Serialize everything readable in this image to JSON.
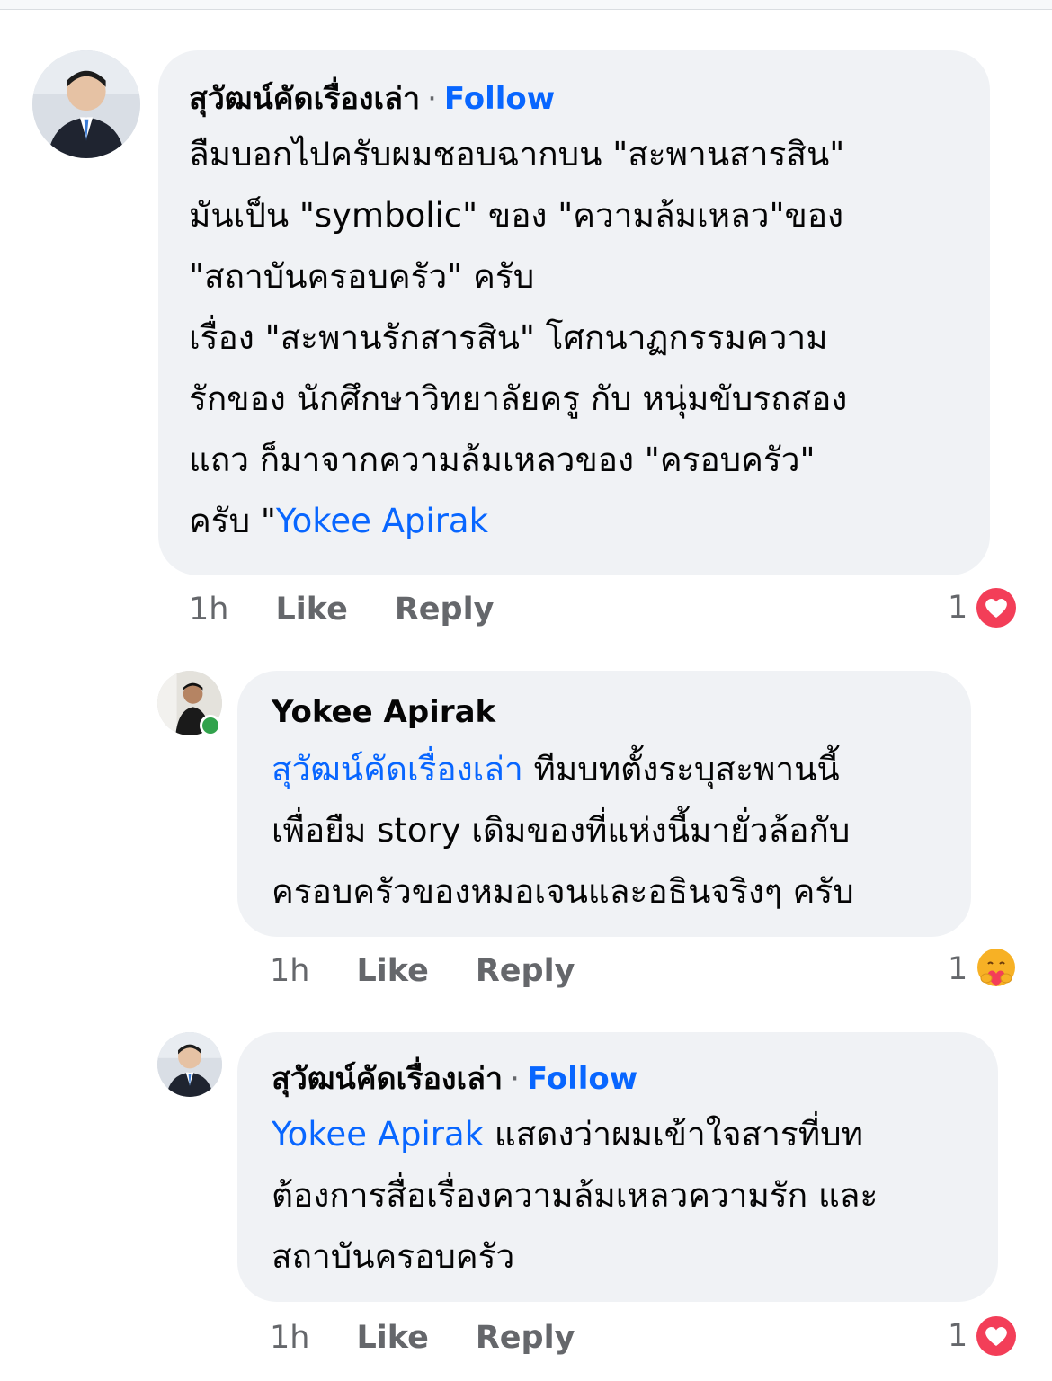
{
  "comments": [
    {
      "author": "สุวัฒน์คัดเรื่องเล่า",
      "separator": "·",
      "follow_label": "Follow",
      "text": "ลืมบอกไปครับผมชอบฉากบน \"สะพานสารสิน\"\nมันเป็น \"symbolic\" ของ \"ความล้มเหลว\"ของ\n\"สถาบันครอบครัว\" ครับ\n  เรื่อง \"สะพานรักสารสิน\" โศกนาฏกรรมความ\nรักของ นักศึกษาวิทยาลัยครู กับ หนุ่มขับรถสอง\nแถว ก็มาจากความล้มเหลวของ \"ครอบครัว\"\nครับ \"",
      "mention": "Yokee Apirak",
      "time": "1h",
      "like_label": "Like",
      "reply_label": "Reply",
      "reaction_count": "1",
      "reaction_icon": "love-heart-icon"
    },
    {
      "author": "Yokee Apirak",
      "mention": "สุวัฒน์คัดเรื่องเล่า",
      "text": " ทีมบทตั้งระบุสะพานนี้\nเพื่อยืม story เดิมของที่แห่งนี้มายั่วล้อกับ\nครอบครัวของหมอเจนและอธินจริงๆ ครับ",
      "time": "1h",
      "like_label": "Like",
      "reply_label": "Reply",
      "reaction_count": "1",
      "reaction_icon": "care-hug-icon"
    },
    {
      "author": "สุวัฒน์คัดเรื่องเล่า",
      "separator": "·",
      "follow_label": "Follow",
      "mention": "Yokee Apirak",
      "text": " แสดงว่าผมเข้าใจสารที่บท\nต้องการสื่อเรื่องความล้มเหลวความรัก และ\nสถาบันครอบครัว",
      "time": "1h",
      "like_label": "Like",
      "reply_label": "Reply",
      "reaction_count": "1",
      "reaction_icon": "love-heart-icon"
    }
  ],
  "colors": {
    "bubble": "#f0f2f5",
    "link": "#0866ff",
    "meta": "#65676b",
    "love": "#f33e58",
    "care": "#f7b125",
    "online": "#31a24c"
  }
}
